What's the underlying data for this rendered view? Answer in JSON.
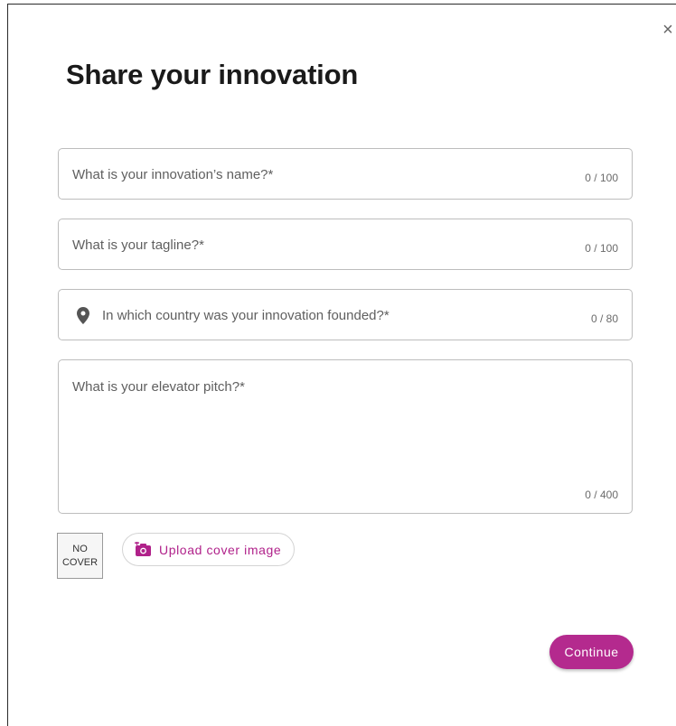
{
  "dialog": {
    "title": "Share your innovation",
    "close_icon": "close-icon",
    "close_symbol": "×"
  },
  "fields": {
    "name": {
      "placeholder": "What is your innovation’s name?*",
      "counter": "0 / 100"
    },
    "tagline": {
      "placeholder": "What is your tagline?*",
      "counter": "0 / 100"
    },
    "country": {
      "placeholder": "In which country was your innovation founded?*",
      "counter": "0 / 80",
      "icon": "location-pin-icon"
    },
    "pitch": {
      "placeholder": "What is your elevator pitch?*",
      "counter": "0 / 400"
    }
  },
  "cover": {
    "no_cover_label": "NO COVER",
    "upload_label": "Upload cover image",
    "upload_icon": "camera-plus-icon"
  },
  "actions": {
    "continue_label": "Continue"
  },
  "colors": {
    "accent": "#b42a8e",
    "accent_text": "#b0218a",
    "border": "#bdbdbd",
    "placeholder": "#5f5f5f"
  }
}
